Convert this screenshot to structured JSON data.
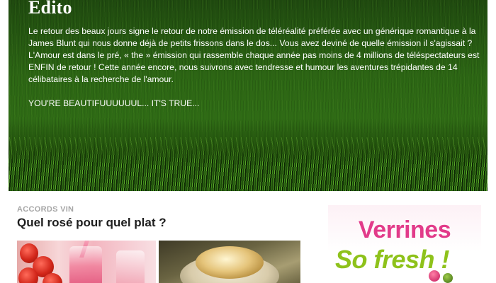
{
  "edito": {
    "title": "Edito",
    "paragraph": "Le retour des beaux jours signe le retour de notre émission de téléréalité préférée avec un générique romantique à la James Blunt qui nous donne déjà de petits frissons dans le dos... Vous avez deviné de quelle émission il s'agissait ? L'Amour est dans le pré, « the » émission qui rassemble chaque année pas moins de 4 millions de téléspectateurs est ENFIN de retour ! Cette année encore, nous suivrons avec tendresse et humour les aventures trépidantes de 14 célibataires à la recherche de l'amour.",
    "tagline": "YOU'RE BEAUTIFUUUUUUL... IT'S TRUE..."
  },
  "teaser": {
    "category": "ACCORDS VIN",
    "title": "Quel rosé pour quel plat ?"
  },
  "ad": {
    "line1": "Verrines",
    "line2": "So fresh !"
  },
  "colors": {
    "grass": "#2c6614",
    "category_gray": "#a6a6a6",
    "ad_pink": "#e23b8a",
    "ad_green": "#8ec21b"
  }
}
